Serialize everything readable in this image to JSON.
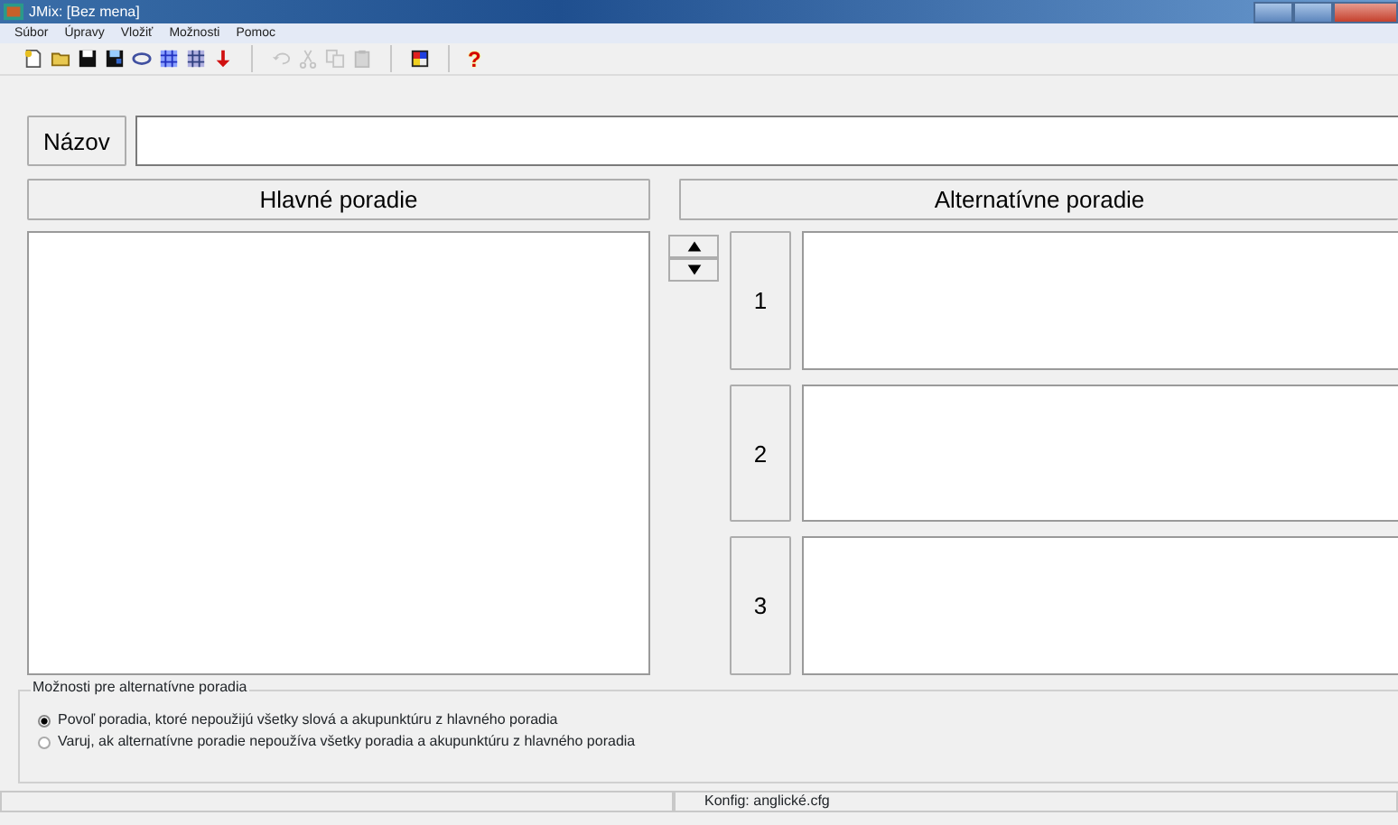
{
  "window": {
    "title": "JMix: [Bez mena]"
  },
  "menu": [
    "Súbor",
    "Úpravy",
    "Vložiť",
    "Možnosti",
    "Pomoc"
  ],
  "toolbar": [
    [
      {
        "kind": "new",
        "disabled": false
      },
      {
        "kind": "open",
        "disabled": false
      },
      {
        "kind": "save",
        "disabled": false
      },
      {
        "kind": "saveas",
        "disabled": false
      },
      {
        "kind": "link",
        "disabled": false
      },
      {
        "kind": "gridA",
        "disabled": false
      },
      {
        "kind": "gridB",
        "disabled": false
      },
      {
        "kind": "arrow",
        "disabled": false
      }
    ],
    [
      {
        "kind": "undo",
        "disabled": true
      },
      {
        "kind": "cut",
        "disabled": true
      },
      {
        "kind": "copy",
        "disabled": true
      },
      {
        "kind": "paste",
        "disabled": true
      }
    ],
    [
      {
        "kind": "web",
        "disabled": false
      }
    ],
    [
      {
        "kind": "help",
        "disabled": false,
        "glyph": "?"
      }
    ]
  ],
  "title_field": {
    "label": "Názov"
  },
  "main_order": {
    "heading": "Hlavné poradie"
  },
  "alternative_order": {
    "heading": "Alternatívne poradie",
    "slots": [
      {
        "number": "1"
      },
      {
        "number": "2"
      },
      {
        "number": "3"
      }
    ]
  },
  "options": {
    "legend": "Možnosti pre alternatívne poradia",
    "radios": [
      {
        "label": "Povoľ poradia, ktoré nepoužijú všetky slová a akupunktúru z hlavného poradia",
        "selected": true
      },
      {
        "label": "Varuj, ak alternatívne poradie nepoužíva všetky poradia a akupunktúru z hlavného poradia",
        "selected": false
      }
    ]
  },
  "status_bar": {
    "text": "Konfig: anglické.cfg"
  }
}
